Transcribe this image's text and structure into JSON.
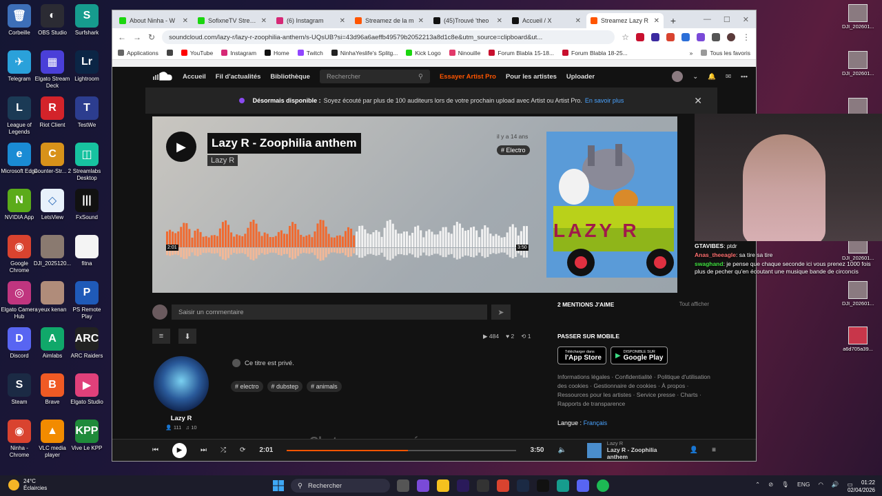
{
  "desktop": {
    "col1": [
      {
        "label": "Corbeille",
        "color": "#3d6fb8",
        "glyph": "🗑"
      },
      {
        "label": "Telegram",
        "color": "#2aa1da",
        "glyph": "✈"
      },
      {
        "label": "League of Legends",
        "color": "#1b3a55",
        "glyph": "L"
      },
      {
        "label": "Microsoft Edge",
        "color": "#1a8bd4",
        "glyph": "e"
      },
      {
        "label": "NVIDIA App",
        "color": "#5bab1a",
        "glyph": "N"
      },
      {
        "label": "Google Chrome",
        "color": "#d9432f",
        "glyph": "◉"
      },
      {
        "label": "Elgato Camera Hub",
        "color": "#c0357f",
        "glyph": "◎"
      },
      {
        "label": "Discord",
        "color": "#5865f2",
        "glyph": "D"
      },
      {
        "label": "Steam",
        "color": "#1b2a44",
        "glyph": "S"
      },
      {
        "label": "Ninha - Chrome",
        "color": "#d9432f",
        "glyph": "◉"
      }
    ],
    "col2": [
      {
        "label": "OBS Studio",
        "color": "#2b2b33",
        "glyph": "◐"
      },
      {
        "label": "Elgato Stream Deck",
        "color": "#4a3fd8",
        "glyph": "▦"
      },
      {
        "label": "Riot Client",
        "color": "#d3232a",
        "glyph": "R"
      },
      {
        "label": "Counter-Str... 2",
        "color": "#d8921a",
        "glyph": "C"
      },
      {
        "label": "LetsView",
        "color": "#e8f1fb",
        "glyph": "◇"
      },
      {
        "label": "DJI_2025120...",
        "color": "#8a7a70",
        "glyph": ""
      },
      {
        "label": "yeux kenan",
        "color": "#b08c7a",
        "glyph": ""
      },
      {
        "label": "Aimlabs",
        "color": "#10a86a",
        "glyph": "A"
      },
      {
        "label": "Brave",
        "color": "#f05a24",
        "glyph": "B"
      },
      {
        "label": "VLC media player",
        "color": "#f28b00",
        "glyph": "▲"
      }
    ],
    "col3": [
      {
        "label": "Surfshark",
        "color": "#169c8e",
        "glyph": "S"
      },
      {
        "label": "Lightroom",
        "color": "#0b2545",
        "glyph": "Lr"
      },
      {
        "label": "TestWe",
        "color": "#2c3d8f",
        "glyph": "T"
      },
      {
        "label": "Streamlabs Desktop",
        "color": "#17c3a0",
        "glyph": "◫"
      },
      {
        "label": "FxSound",
        "color": "#111111",
        "glyph": "|||"
      },
      {
        "label": "fitna",
        "color": "#f4f4f4",
        "glyph": ""
      },
      {
        "label": "PS Remote Play",
        "color": "#1f5ab8",
        "glyph": "P"
      },
      {
        "label": "ARC Raiders",
        "color": "#222222",
        "glyph": "ARC"
      },
      {
        "label": "Elgato Studio",
        "color": "#e0407a",
        "glyph": "▶"
      },
      {
        "label": "Vive Le KPP",
        "color": "#1f8a3a",
        "glyph": "KPP"
      }
    ],
    "right_files": [
      "DJI_202601...",
      "DJI_202601...",
      "DJI_202601...",
      "DJI_202601...",
      "DJI_202601...",
      "a6d705a39..."
    ]
  },
  "browser": {
    "tabs": [
      {
        "label": "About Ninha - W",
        "color": "#1bd60f"
      },
      {
        "label": "SofixneTV Stream",
        "color": "#1bd60f"
      },
      {
        "label": "(6) Instagram",
        "color": "#d62976"
      },
      {
        "label": "Streamez de la m",
        "color": "#ff5500"
      },
      {
        "label": "(45)Trouvé 'theo",
        "color": "#111111"
      },
      {
        "label": "Accueil / X",
        "color": "#111111"
      },
      {
        "label": "Streamez Lazy R",
        "color": "#ff5500"
      }
    ],
    "new_tab": "+",
    "url": "soundcloud.com/lazy-r/lazy-r-zoophilia-anthem/s-UQsUB?si=43d96a6aeffb49579b2052213a8d1c8e&utm_source=clipboard&ut...",
    "bookmarks": [
      {
        "label": "Applications",
        "color": "#666666"
      },
      {
        "label": "",
        "color": "#444444"
      },
      {
        "label": "YouTube",
        "color": "#ff0000"
      },
      {
        "label": "Instagram",
        "color": "#d62976"
      },
      {
        "label": "Home",
        "color": "#111111"
      },
      {
        "label": "Twitch",
        "color": "#9146ff"
      },
      {
        "label": "NinhaYeslife's Splitg...",
        "color": "#222222"
      },
      {
        "label": "Kick Logo",
        "color": "#1bd60f"
      },
      {
        "label": "Ninouille",
        "color": "#e23a6a"
      },
      {
        "label": "Forum Blabla 15-18...",
        "color": "#c8102e"
      },
      {
        "label": "Forum Blabla 18-25...",
        "color": "#c8102e"
      }
    ],
    "all_favorites": "Tous les favoris"
  },
  "soundcloud": {
    "nav": [
      "Accueil",
      "Fil d'actualités",
      "Bibliothèque"
    ],
    "search_placeholder": "Rechercher",
    "try_pro": "Essayer Artist Pro",
    "for_artists": "Pour les artistes",
    "upload": "Uploader",
    "banner": {
      "strong": "Désormais disponible :",
      "text": "Soyez écouté par plus de 100 auditeurs lors de votre prochain upload avec Artist ou Artist Pro.",
      "link": "En savoir plus"
    },
    "track": {
      "title": "Lazy R - Zoophilia anthem",
      "artist": "Lazy R",
      "ago": "il y a 14 ans",
      "genre_tag": "# Electro",
      "time_current": "2:01",
      "time_total": "3:50",
      "artwork_text": "LAZY R"
    },
    "comment_placeholder": "Saisir un commentaire",
    "stats": {
      "plays": "484",
      "likes": "2",
      "reposts": "1"
    },
    "private_note": "Ce titre est privé.",
    "tags": [
      "# electro",
      "# dubstep",
      "# animals"
    ],
    "artist_card": {
      "name": "Lazy R",
      "followers": "111",
      "tracks": "10"
    },
    "ghost_heading": "Chatons remarqués",
    "sidebar": {
      "likes_heading": "2 MENTIONS J'AIME",
      "show_all": "Tout afficher",
      "mobile_heading": "PASSER SUR MOBILE",
      "appstore_small": "Télécharger dans",
      "appstore": "l'App Store",
      "googleplay_small": "DISPONIBLE SUR",
      "googleplay": "Google Play",
      "legal": "Informations légales · Confidentialité · Politique d'utilisation des cookies · Gestionnaire de cookies · À propos · Ressources pour les artistes · Service presse · Charts · Rapports de transparence",
      "language_label": "Langue :",
      "language": "Français"
    },
    "player": {
      "current": "2:01",
      "total": "3:50",
      "progress": 0.526,
      "artist": "Lazy R",
      "title": "Lazy R - Zoophilia anthem"
    }
  },
  "overlay": {
    "chat": [
      {
        "user": "GTAVIBES",
        "text": ": ptdr"
      },
      {
        "user": "Anas_theeagle",
        "text": ": sa tire sa tire"
      },
      {
        "user": "swaghand",
        "text": ": je pense que chaque seconde ici vous prenez 1000 fois plus de pecher qu'en écoutant une musique bande de circoncis"
      }
    ]
  },
  "taskbar": {
    "temperature": "24°C",
    "weather": "Éclaircies",
    "search": "Rechercher",
    "lang": "ENG",
    "time": "01:22",
    "date": "02/04/2026"
  }
}
